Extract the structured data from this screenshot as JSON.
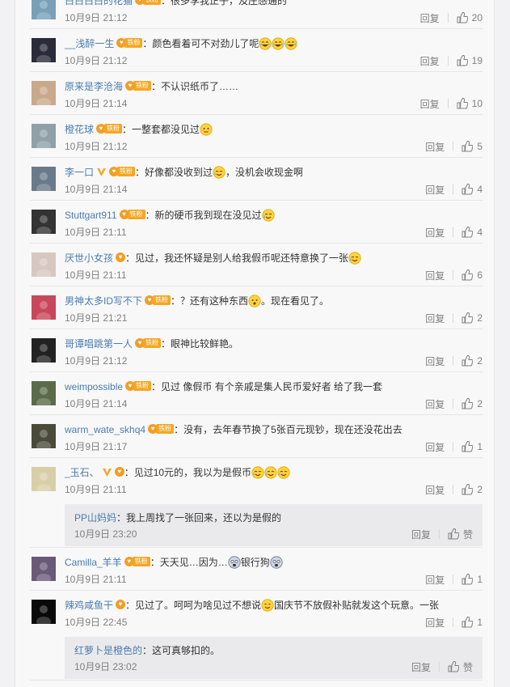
{
  "comments": [
    {
      "user": "白白白白的花猫",
      "fan_tag": "铁粉",
      "sep": "：",
      "text": "很多李我正子，及庄感通的",
      "time": "10月9日 21:12",
      "reply": "回复",
      "likes": "20",
      "avatar_color": "#7a9fb8"
    },
    {
      "user": "__浅醉一生",
      "fan_tag": "铁粉",
      "sep": "：",
      "text": "颜色看着可不对劲儿了呢",
      "time": "10月9日 21:12",
      "reply": "回复",
      "likes": "19",
      "emoji": [
        "laugh-cry",
        "laugh-cry",
        "laugh-cry"
      ],
      "avatar_color": "#2b2b3a"
    },
    {
      "user": "原来是李沧海",
      "fan_tag": "铁粉",
      "sep": "：",
      "text": "不认识纸币了……",
      "time": "10月9日 21:14",
      "reply": "回复",
      "likes": "10",
      "avatar_color": "#c9a98b"
    },
    {
      "user": "橙花球",
      "fan_tag": "铁粉",
      "sep": "：",
      "text": "一整套都没见过",
      "time": "10月9日 21:12",
      "reply": "回复",
      "likes": "5",
      "emoji_after": [
        "awkward"
      ],
      "avatar_color": "#8fa0a8"
    },
    {
      "user": "李一口",
      "verified": true,
      "fan_tag": "铁粉",
      "sep": "：",
      "text": "好像都没收到过",
      "text2": "，没机会收现金啊",
      "time": "10月9日 21:14",
      "reply": "回复",
      "likes": "4",
      "emoji_mid": [
        "cry-laugh"
      ],
      "avatar_color": "#6a7a8a"
    },
    {
      "user": "Stuttgart911",
      "fan_tag": "铁粉",
      "sep": "：",
      "text": "新的硬币我到现在没见过",
      "time": "10月9日 21:11",
      "reply": "回复",
      "likes": "4",
      "emoji_after": [
        "cry-laugh"
      ],
      "avatar_color": "#333"
    },
    {
      "user": "厌世小女孩",
      "fan_tag": "",
      "sep": "：",
      "text": "见过，我还怀疑是别人给我假币呢还特意换了一张",
      "time": "10月9日 21:11",
      "reply": "回复",
      "likes": "6",
      "emoji_after": [
        "cry-laugh"
      ],
      "avatar_color": "#d8c7c0"
    },
    {
      "user": "男神太多ID写不下",
      "fan_tag": "铁粉",
      "sep": "：",
      "text": "？还有这种东西",
      "text2": "。现在看见了。",
      "time": "10月9日 21:21",
      "reply": "回复",
      "likes": "2",
      "emoji_mid": [
        "doubt"
      ],
      "avatar_color": "#c8475a"
    },
    {
      "user": "哥谭唱跳第一人",
      "fan_tag": "铁粉",
      "sep": "：",
      "text": "眼神比较鲜艳。",
      "time": "10月9日 21:12",
      "reply": "回复",
      "likes": "2",
      "avatar_color": "#222"
    },
    {
      "user": "weimpossible",
      "fan_tag": "铁粉",
      "sep": "：",
      "text": "见过 像假币 有个亲戚是集人民币爱好者 给了我一套",
      "time": "10月9日 21:14",
      "reply": "回复",
      "likes": "2",
      "avatar_color": "#5b6b4a"
    },
    {
      "user": "warm_wate_skhq4",
      "fan_tag": "铁粉",
      "sep": "：",
      "text": "没有，去年春节换了5张百元现钞，现在还没花出去",
      "time": "10月9日 21:17",
      "reply": "回复",
      "likes": "1",
      "avatar_color": "#4a4a3a"
    },
    {
      "user": "_玉石、",
      "verified": true,
      "fan_tag": "",
      "sep": "：",
      "text": "见过10元的，我以为是假币",
      "time": "10月9日 21:11",
      "reply": "回复",
      "likes": "2",
      "emoji_after": [
        "cry-laugh",
        "cry-laugh",
        "cry-laugh"
      ],
      "avatar_color": "#d8cfa8",
      "sub": {
        "user": "PP山妈妈",
        "sep": "：",
        "text": "我上周找了一张回来，还以为是假的",
        "time": "10月9日 23:20",
        "reply": "回复",
        "like_label": "赞"
      }
    },
    {
      "user": "Camilla_羊羊",
      "fan_tag": "铁粉",
      "sep": "：",
      "text": "天天见…因为…",
      "text2": "银行狗",
      "time": "10月9日 21:11",
      "reply": "回复",
      "likes": "1",
      "emoji_mid": [
        "scared"
      ],
      "emoji_after": [
        "scared"
      ],
      "avatar_color": "#6a5a7a"
    },
    {
      "user": "辣鸡咸鱼干",
      "fan_tag": "",
      "sep": "：",
      "text": "见过了。呵呵为啥见过不想说",
      "text2": "国庆节不放假补贴就发这个玩意。一张",
      "time": "10月9日 22:45",
      "reply": "回复",
      "likes": "1",
      "emoji_mid": [
        "smile"
      ],
      "avatar_color": "#0a0a0a",
      "sub": {
        "user": "红萝卜是橙色的",
        "sep": "：",
        "text": "这可真够扣的。",
        "time": "10月9日 23:02",
        "reply": "回复",
        "like_label": "赞"
      }
    }
  ],
  "colors": {
    "link": "#4b7cae",
    "meta": "#808080",
    "fan_badge": "#f29e24"
  }
}
